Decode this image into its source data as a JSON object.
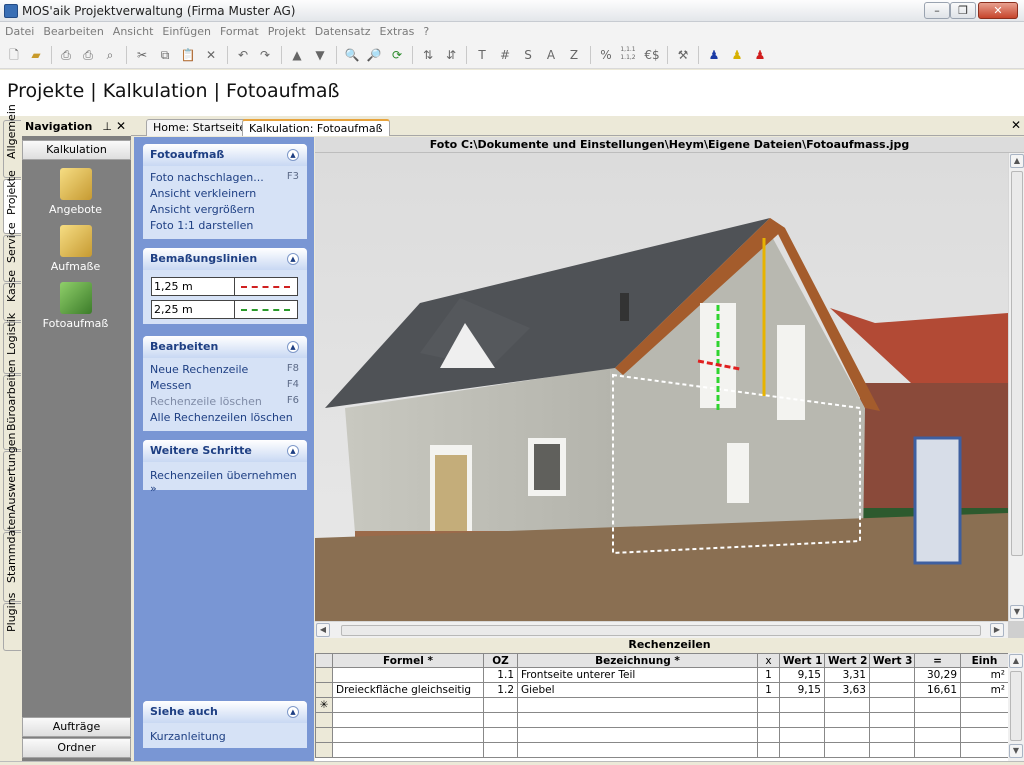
{
  "window": {
    "title": "MOS'aik Projektverwaltung (Firma Muster AG)",
    "min": "–",
    "max": "❐",
    "close": "✕"
  },
  "menu": [
    "Datei",
    "Bearbeiten",
    "Ansicht",
    "Einfügen",
    "Format",
    "Projekt",
    "Datensatz",
    "Extras",
    "?"
  ],
  "toolbar": {
    "text_buttons": [
      "T",
      "#",
      "S",
      "A",
      "Z",
      "%",
      "1,1.1\n1.1,2",
      "€$"
    ]
  },
  "header": {
    "title": "Projekte | Kalkulation | Fotoaufmaß"
  },
  "vertical_tabs": [
    "Allgemein",
    "Projekte",
    "Service",
    "Kasse",
    "Logistik",
    "Büroarbeiten",
    "Auswertungen",
    "Stammdaten",
    "Plugins"
  ],
  "navigation": {
    "title": "Navigation",
    "pin": "⊥",
    "close": "✕",
    "section": "Kalkulation",
    "items": [
      "Angebote",
      "Aufmaße",
      "Fotoaufmaß"
    ],
    "bottom_buttons": [
      "Aufträge",
      "Ordner"
    ]
  },
  "tabs": [
    {
      "label": "Home: Startseite"
    },
    {
      "label": "Kalkulation: Fotoaufmaß"
    }
  ],
  "tabs_close": "✕",
  "taskpane": {
    "fotoaufmass": {
      "title": "Fotoaufmaß",
      "items": [
        {
          "label": "Foto nachschlagen...",
          "key": "F3"
        },
        {
          "label": "Ansicht verkleinern",
          "key": ""
        },
        {
          "label": "Ansicht vergrößern",
          "key": ""
        },
        {
          "label": "Foto 1:1 darstellen",
          "key": ""
        }
      ]
    },
    "bemassung": {
      "title": "Bemaßungslinien",
      "lines": [
        {
          "value": "1,25 m",
          "color": "#d02020"
        },
        {
          "value": "2,25 m",
          "color": "#2a9a2a"
        }
      ]
    },
    "bearbeiten": {
      "title": "Bearbeiten",
      "items": [
        {
          "label": "Neue Rechenzeile",
          "key": "F8",
          "disabled": false
        },
        {
          "label": "Messen",
          "key": "F4",
          "disabled": false
        },
        {
          "label": "Rechenzeile löschen",
          "key": "F6",
          "disabled": true
        },
        {
          "label": "Alle Rechenzeilen löschen",
          "key": "",
          "disabled": false
        }
      ]
    },
    "weitere": {
      "title": "Weitere Schritte",
      "items": [
        {
          "label": "Rechenzeilen übernehmen »"
        }
      ]
    },
    "siehe": {
      "title": "Siehe auch",
      "items": [
        {
          "label": "Kurzanleitung"
        }
      ]
    }
  },
  "photo": {
    "caption": "Foto C:\\Dokumente und Einstellungen\\Heym\\Eigene Dateien\\Fotoaufmass.jpg"
  },
  "grid": {
    "title": "Rechenzeilen",
    "columns": [
      "Formel *",
      "OZ",
      "Bezeichnung *",
      "x",
      "Wert 1",
      "Wert 2",
      "Wert 3",
      "=",
      "Einh"
    ],
    "rows": [
      [
        "",
        "1.1",
        "Frontseite unterer Teil",
        "1",
        "9,15",
        "3,31",
        "",
        "30,29",
        "m²"
      ],
      [
        "Dreieckfläche gleichseitig",
        "1.2",
        "Giebel",
        "1",
        "9,15",
        "3,63",
        "",
        "16,61",
        "m²"
      ]
    ],
    "new_row_marker": "✳"
  }
}
